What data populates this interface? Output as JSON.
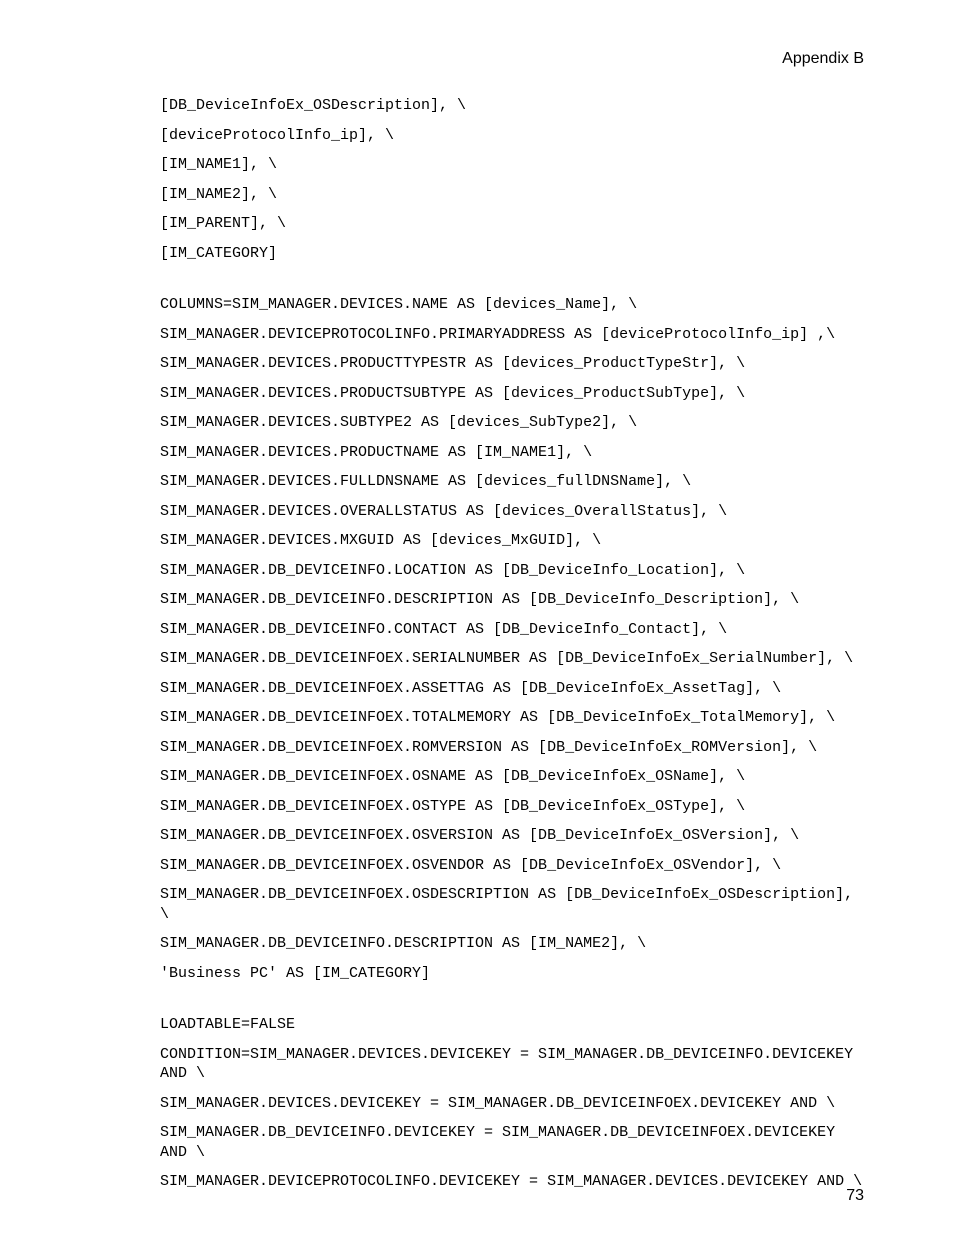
{
  "header": "Appendix B",
  "page_number": "73",
  "lines": [
    "[DB_DeviceInfoEx_OSDescription], \\",
    "[deviceProtocolInfo_ip], \\",
    "[IM_NAME1], \\",
    "[IM_NAME2], \\",
    "[IM_PARENT], \\",
    "[IM_CATEGORY]",
    "",
    "",
    "COLUMNS=SIM_MANAGER.DEVICES.NAME AS [devices_Name], \\",
    "SIM_MANAGER.DEVICEPROTOCOLINFO.PRIMARYADDRESS AS [deviceProtocolInfo_ip] ,\\",
    "SIM_MANAGER.DEVICES.PRODUCTTYPESTR AS [devices_ProductTypeStr], \\",
    "SIM_MANAGER.DEVICES.PRODUCTSUBTYPE AS [devices_ProductSubType], \\",
    "SIM_MANAGER.DEVICES.SUBTYPE2 AS [devices_SubType2], \\",
    "SIM_MANAGER.DEVICES.PRODUCTNAME AS [IM_NAME1], \\",
    "SIM_MANAGER.DEVICES.FULLDNSNAME AS [devices_fullDNSName], \\",
    "SIM_MANAGER.DEVICES.OVERALLSTATUS AS [devices_OverallStatus], \\",
    "SIM_MANAGER.DEVICES.MXGUID AS [devices_MxGUID], \\",
    "SIM_MANAGER.DB_DEVICEINFO.LOCATION AS [DB_DeviceInfo_Location], \\",
    "SIM_MANAGER.DB_DEVICEINFO.DESCRIPTION AS [DB_DeviceInfo_Description], \\",
    "SIM_MANAGER.DB_DEVICEINFO.CONTACT AS [DB_DeviceInfo_Contact], \\",
    "SIM_MANAGER.DB_DEVICEINFOEX.SERIALNUMBER AS [DB_DeviceInfoEx_SerialNumber], \\",
    "SIM_MANAGER.DB_DEVICEINFOEX.ASSETTAG AS [DB_DeviceInfoEx_AssetTag], \\",
    "SIM_MANAGER.DB_DEVICEINFOEX.TOTALMEMORY AS [DB_DeviceInfoEx_TotalMemory], \\",
    "SIM_MANAGER.DB_DEVICEINFOEX.ROMVERSION AS [DB_DeviceInfoEx_ROMVersion], \\",
    "SIM_MANAGER.DB_DEVICEINFOEX.OSNAME AS [DB_DeviceInfoEx_OSName], \\",
    "SIM_MANAGER.DB_DEVICEINFOEX.OSTYPE AS [DB_DeviceInfoEx_OSType], \\",
    "SIM_MANAGER.DB_DEVICEINFOEX.OSVERSION AS [DB_DeviceInfoEx_OSVersion], \\",
    "SIM_MANAGER.DB_DEVICEINFOEX.OSVENDOR AS [DB_DeviceInfoEx_OSVendor], \\",
    "SIM_MANAGER.DB_DEVICEINFOEX.OSDESCRIPTION AS [DB_DeviceInfoEx_OSDescription], \\",
    "SIM_MANAGER.DB_DEVICEINFO.DESCRIPTION AS [IM_NAME2], \\",
    "'Business PC' AS [IM_CATEGORY]",
    "",
    "",
    "LOADTABLE=FALSE",
    "CONDITION=SIM_MANAGER.DEVICES.DEVICEKEY = SIM_MANAGER.DB_DEVICEINFO.DEVICEKEY AND \\",
    "SIM_MANAGER.DEVICES.DEVICEKEY = SIM_MANAGER.DB_DEVICEINFOEX.DEVICEKEY AND \\",
    "SIM_MANAGER.DB_DEVICEINFO.DEVICEKEY = SIM_MANAGER.DB_DEVICEINFOEX.DEVICEKEY AND \\",
    "SIM_MANAGER.DEVICEPROTOCOLINFO.DEVICEKEY = SIM_MANAGER.DEVICES.DEVICEKEY AND \\"
  ]
}
